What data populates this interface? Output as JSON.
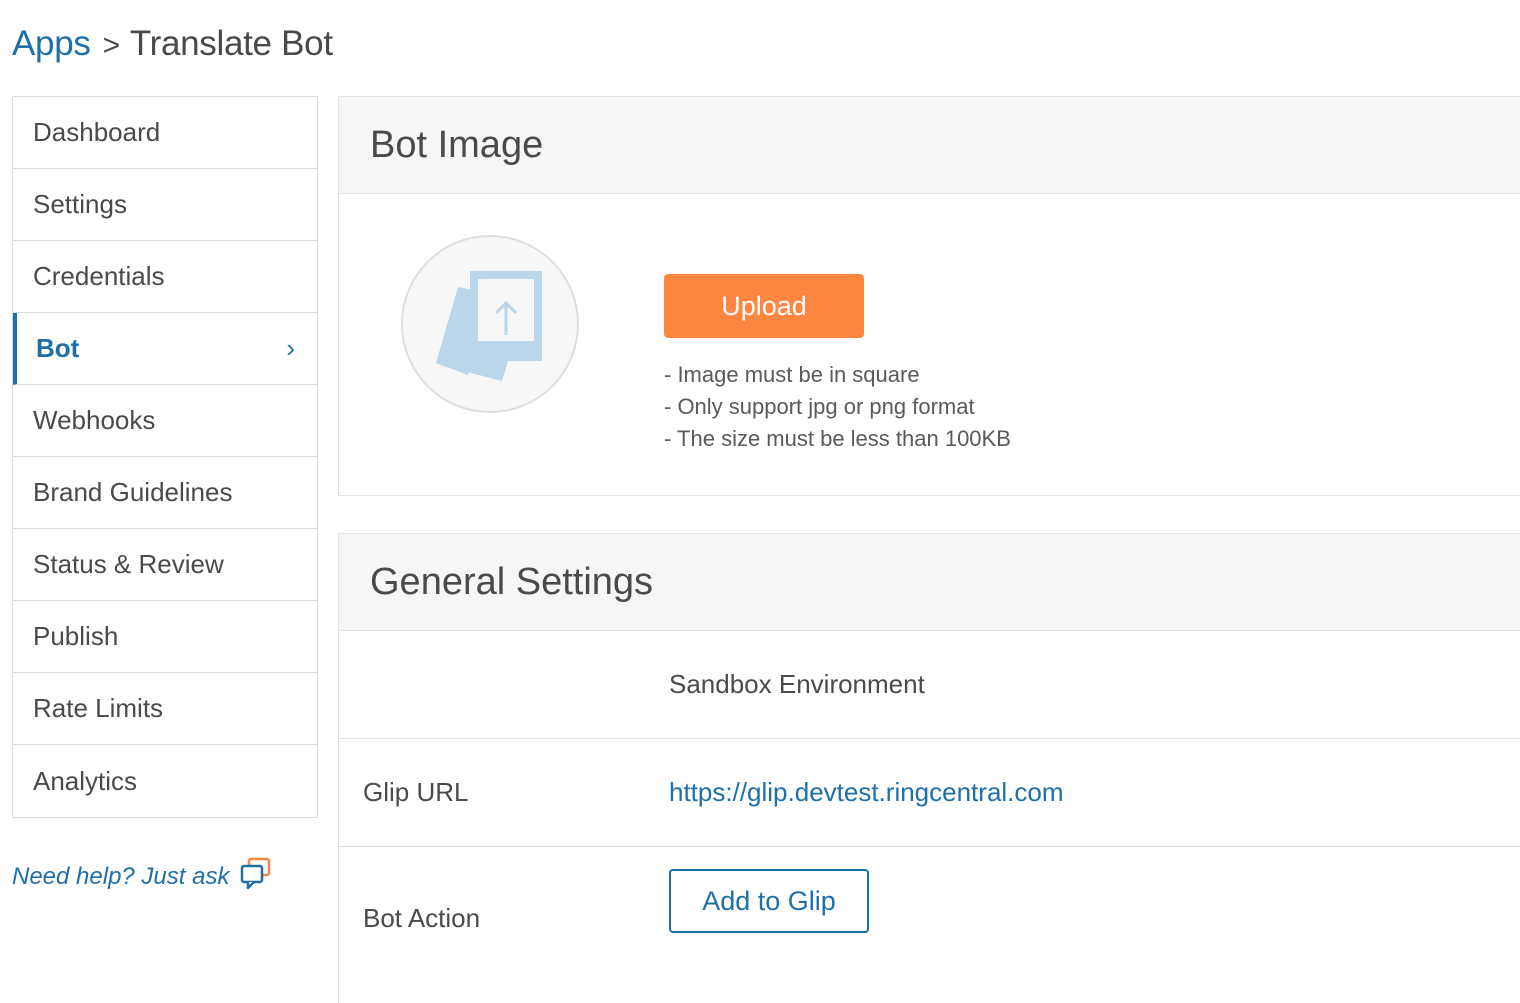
{
  "breadcrumb": {
    "root": "Apps",
    "separator": ">",
    "current": "Translate Bot"
  },
  "sidebar": {
    "items": [
      {
        "label": "Dashboard",
        "active": false
      },
      {
        "label": "Settings",
        "active": false
      },
      {
        "label": "Credentials",
        "active": false
      },
      {
        "label": "Bot",
        "active": true
      },
      {
        "label": "Webhooks",
        "active": false
      },
      {
        "label": "Brand Guidelines",
        "active": false
      },
      {
        "label": "Status & Review",
        "active": false
      },
      {
        "label": "Publish",
        "active": false
      },
      {
        "label": "Rate Limits",
        "active": false
      },
      {
        "label": "Analytics",
        "active": false
      }
    ],
    "active_chevron": "›"
  },
  "help": {
    "label": "Need help? Just ask",
    "icon": "chat-bubbles-icon"
  },
  "bot_image": {
    "title": "Bot Image",
    "placeholder_icon": "image-upload-placeholder-icon",
    "upload_label": "Upload",
    "rules": [
      "- Image must be in square",
      "- Only support jpg or png format",
      "- The size must be less than 100KB"
    ]
  },
  "general_settings": {
    "title": "General Settings",
    "environment_header": "Sandbox Environment",
    "glip_url_label": "Glip URL",
    "glip_url_value": "https://glip.devtest.ringcentral.com",
    "bot_action_label": "Bot Action",
    "add_to_glip_label": "Add to Glip"
  },
  "colors": {
    "accent": "#1f6fa8",
    "upload_button": "#ff8640",
    "header_bg": "#f6f6f6",
    "border": "#e2e2e2"
  }
}
